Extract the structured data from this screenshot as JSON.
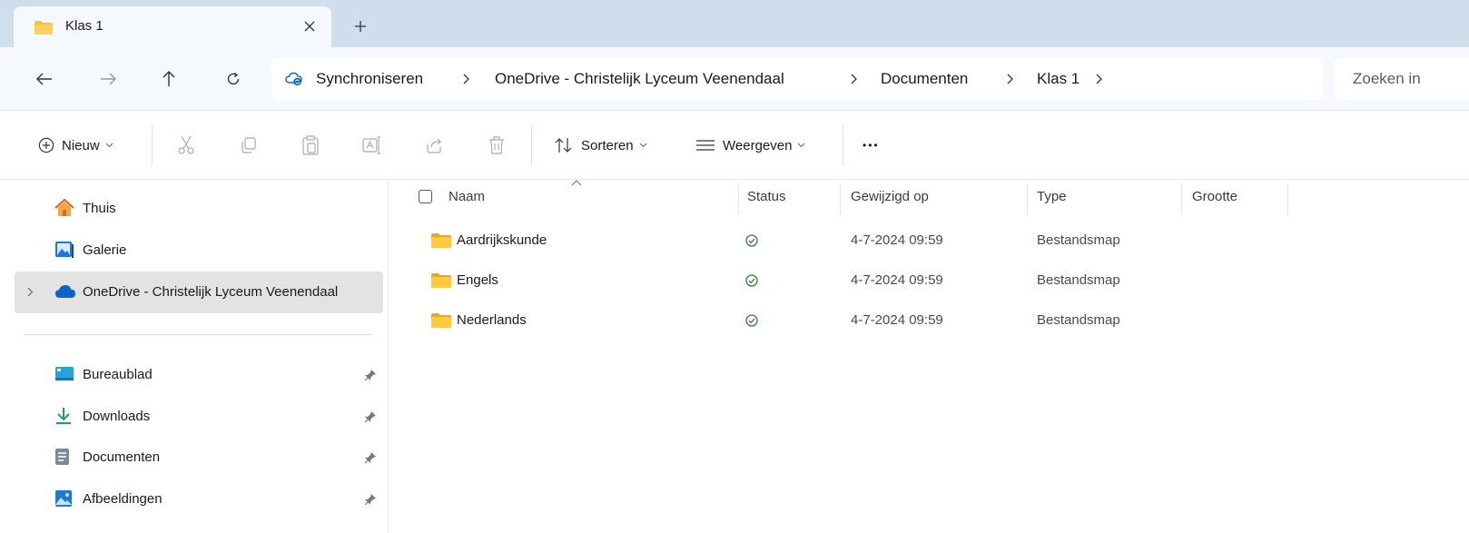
{
  "tab": {
    "title": "Klas 1",
    "close_symbol": "×",
    "new_tab_symbol": "+"
  },
  "breadcrumbs": [
    "Synchroniseren",
    "OneDrive - Christelijk Lyceum Veenendaal",
    "Documenten",
    "Klas 1"
  ],
  "search": {
    "placeholder": "Zoeken in"
  },
  "toolbar": {
    "new_label": "Nieuw",
    "sort_label": "Sorteren",
    "view_label": "Weergeven",
    "more_symbol": "•••"
  },
  "sidebar": {
    "items": [
      {
        "label": "Thuis",
        "icon": "home-icon"
      },
      {
        "label": "Galerie",
        "icon": "gallery-icon"
      },
      {
        "label": "OneDrive - Christelijk Lyceum Veenendaal",
        "icon": "cloud-icon",
        "selected": true
      }
    ],
    "pinned": [
      {
        "label": "Bureaublad",
        "icon": "desktop-icon"
      },
      {
        "label": "Downloads",
        "icon": "download-icon"
      },
      {
        "label": "Documenten",
        "icon": "document-icon"
      },
      {
        "label": "Afbeeldingen",
        "icon": "pictures-icon"
      }
    ]
  },
  "columns": {
    "name": "Naam",
    "status": "Status",
    "modified": "Gewijzigd op",
    "type": "Type",
    "size": "Grootte"
  },
  "files": [
    {
      "name": "Aardrijkskunde",
      "status": "synced",
      "modified": "4-7-2024 09:59",
      "type": "Bestandsmap"
    },
    {
      "name": "Engels",
      "status": "synced",
      "modified": "4-7-2024 09:59",
      "type": "Bestandsmap"
    },
    {
      "name": "Nederlands",
      "status": "synced",
      "modified": "4-7-2024 09:59",
      "type": "Bestandsmap"
    }
  ],
  "colors": {
    "tabbar": "#cfdeec",
    "address_row": "#f5f8fc",
    "folder": "#f8c33b",
    "onedrive_blue": "#0a64c8",
    "synced_green": "#2e7d32"
  }
}
